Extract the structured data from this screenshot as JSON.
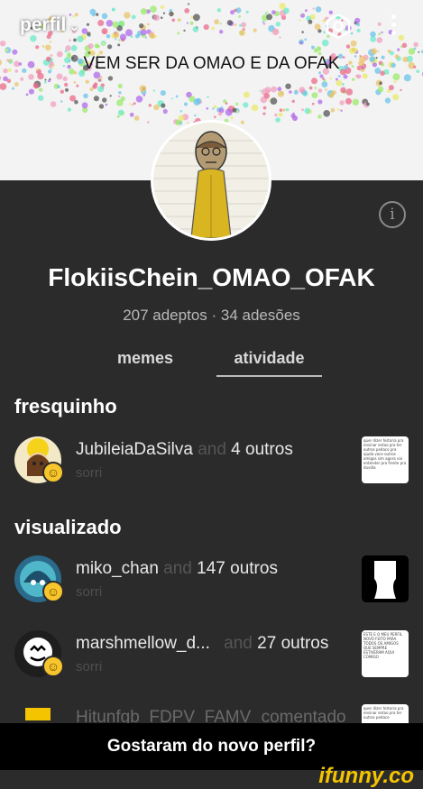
{
  "header": {
    "title": "perfil",
    "banner_text": "VEM SER DA OMAO E DA OFAK"
  },
  "profile": {
    "username": "FlokiisChein_OMAO_OFAK",
    "stats": "207 adeptos · 34 adesões"
  },
  "tabs": [
    {
      "label": "memes"
    },
    {
      "label": "atividade"
    }
  ],
  "sections": {
    "fresh": "fresquinho",
    "viewed": "visualizado"
  },
  "activity": [
    {
      "name": "JubileiaDaSilva",
      "and": "and",
      "others": "4 outros",
      "sub": "sorri",
      "thumb_text": "quer dizer historia pra ensinar entao pra ter outros pedaco pra ajuda voce outros amigos sim agora vai entender pra frente pra duvida"
    },
    {
      "name": "miko_chan",
      "and": "and",
      "others": "147 outros",
      "sub": "sorri"
    },
    {
      "name": "marshmellow_d...",
      "and": "and",
      "others": "27 outros",
      "sub": "sorri",
      "thumb_text": "ESTE E O MEU PERFIL NOVO FEITO PARA TODOS OS AMIGOS QUE SEMPRE ESTIVERAM AQUI COMIGO"
    },
    {
      "name": "Hitunfgb_FDPV_FAMV",
      "and": "",
      "others": "comentado",
      "sub": "",
      "thumb_text": "quer dizer historia pra ensinar entao pra ter outros pedaco"
    }
  ],
  "caption": "Gostaram do novo perfil?",
  "watermark": "ifunny.co"
}
